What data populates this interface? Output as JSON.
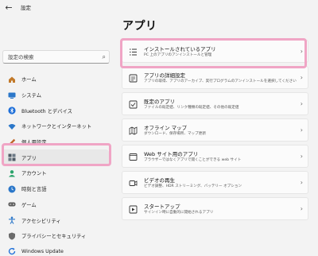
{
  "window": {
    "title": "設定",
    "back": "←"
  },
  "search": {
    "placeholder": "設定の検索",
    "icon": "⌕"
  },
  "sidebar": {
    "items": [
      {
        "label": "ホーム",
        "icon": "home-icon",
        "color": "#c27a2a"
      },
      {
        "label": "システム",
        "icon": "system-icon",
        "color": "#2b77c9"
      },
      {
        "label": "Bluetooth とデバイス",
        "icon": "bluetooth-icon",
        "color": "#1e6fd9"
      },
      {
        "label": "ネットワークとインターネット",
        "icon": "network-icon",
        "color": "#2b77c9"
      },
      {
        "label": "個人用設定",
        "icon": "personalization-icon",
        "color": "#c0662b"
      },
      {
        "label": "アプリ",
        "icon": "apps-icon",
        "color": "#4f5b66"
      },
      {
        "label": "アカウント",
        "icon": "account-icon",
        "color": "#2aa36b"
      },
      {
        "label": "時刻と言語",
        "icon": "time-language-icon",
        "color": "#2b77c9"
      },
      {
        "label": "ゲーム",
        "icon": "game-icon",
        "color": "#5a5a5a"
      },
      {
        "label": "アクセシビリティ",
        "icon": "accessibility-icon",
        "color": "#2b77c9"
      },
      {
        "label": "プライバシーとセキュリティ",
        "icon": "privacy-icon",
        "color": "#6b6b6b"
      },
      {
        "label": "Windows Update",
        "icon": "update-icon",
        "color": "#1e6fd9"
      }
    ],
    "selected_index": 5
  },
  "main": {
    "title": "アプリ",
    "cards": [
      {
        "title": "インストールされているアプリ",
        "subtitle": "PC 上のアプリのアンインストールと管理",
        "icon": "installed-apps-icon"
      },
      {
        "title": "アプリの詳細設定",
        "subtitle": "アプリの取得、アプリのアーカイブ、実行プログラムのアンインストールを選択してください",
        "icon": "advanced-settings-icon"
      },
      {
        "title": "既定のアプリ",
        "subtitle": "ファイルの既定値、リンク種類の既定値、その他の既定値",
        "icon": "default-apps-icon"
      },
      {
        "title": "オフライン マップ",
        "subtitle": "ダウンロード、保存場所、マップ更新",
        "icon": "offline-maps-icon"
      },
      {
        "title": "Web サイト用のアプリ",
        "subtitle": "ブラウザーではなくアプリで開くことができる web サイト",
        "icon": "web-apps-icon"
      },
      {
        "title": "ビデオの再生",
        "subtitle": "ビデオ調整、HDR ストリーミング、バッテリー オプション",
        "icon": "video-playback-icon"
      },
      {
        "title": "スタートアップ",
        "subtitle": "サインイン時に自動的に開始されるアプリ",
        "icon": "startup-icon"
      }
    ]
  },
  "highlight_color": "#f0a5c5"
}
